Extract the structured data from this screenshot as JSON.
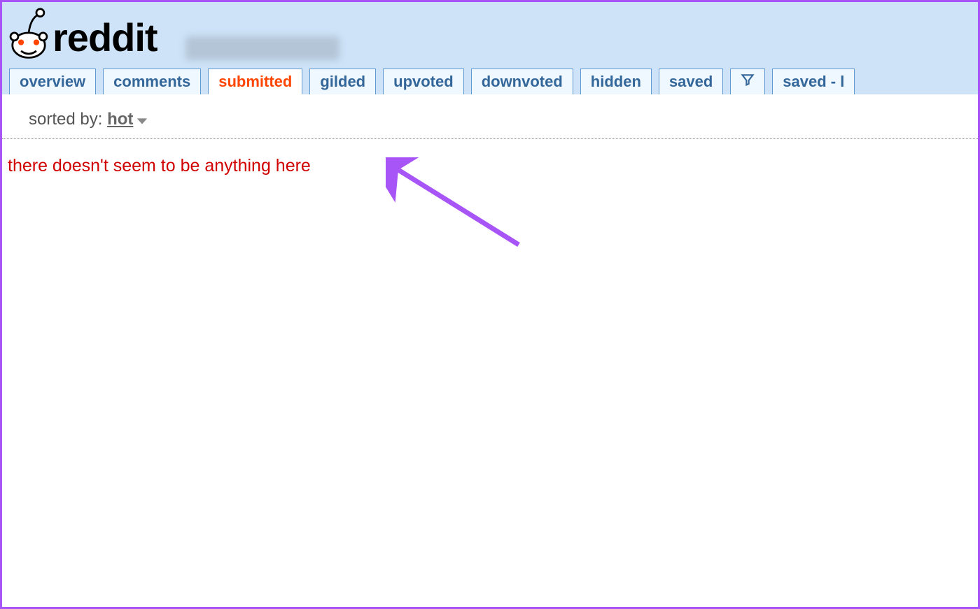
{
  "header": {
    "logo_text": "reddit"
  },
  "tabs": [
    {
      "label": "overview",
      "active": false
    },
    {
      "label": "comments",
      "active": false
    },
    {
      "label": "submitted",
      "active": true
    },
    {
      "label": "gilded",
      "active": false
    },
    {
      "label": "upvoted",
      "active": false
    },
    {
      "label": "downvoted",
      "active": false
    },
    {
      "label": "hidden",
      "active": false
    },
    {
      "label": "saved",
      "active": false
    },
    {
      "label": "",
      "active": false,
      "is_filter_icon": true
    },
    {
      "label": "saved - l",
      "active": false
    }
  ],
  "sort": {
    "prefix": "sorted by: ",
    "current": "hot"
  },
  "empty_message": "there doesn't seem to be anything here"
}
